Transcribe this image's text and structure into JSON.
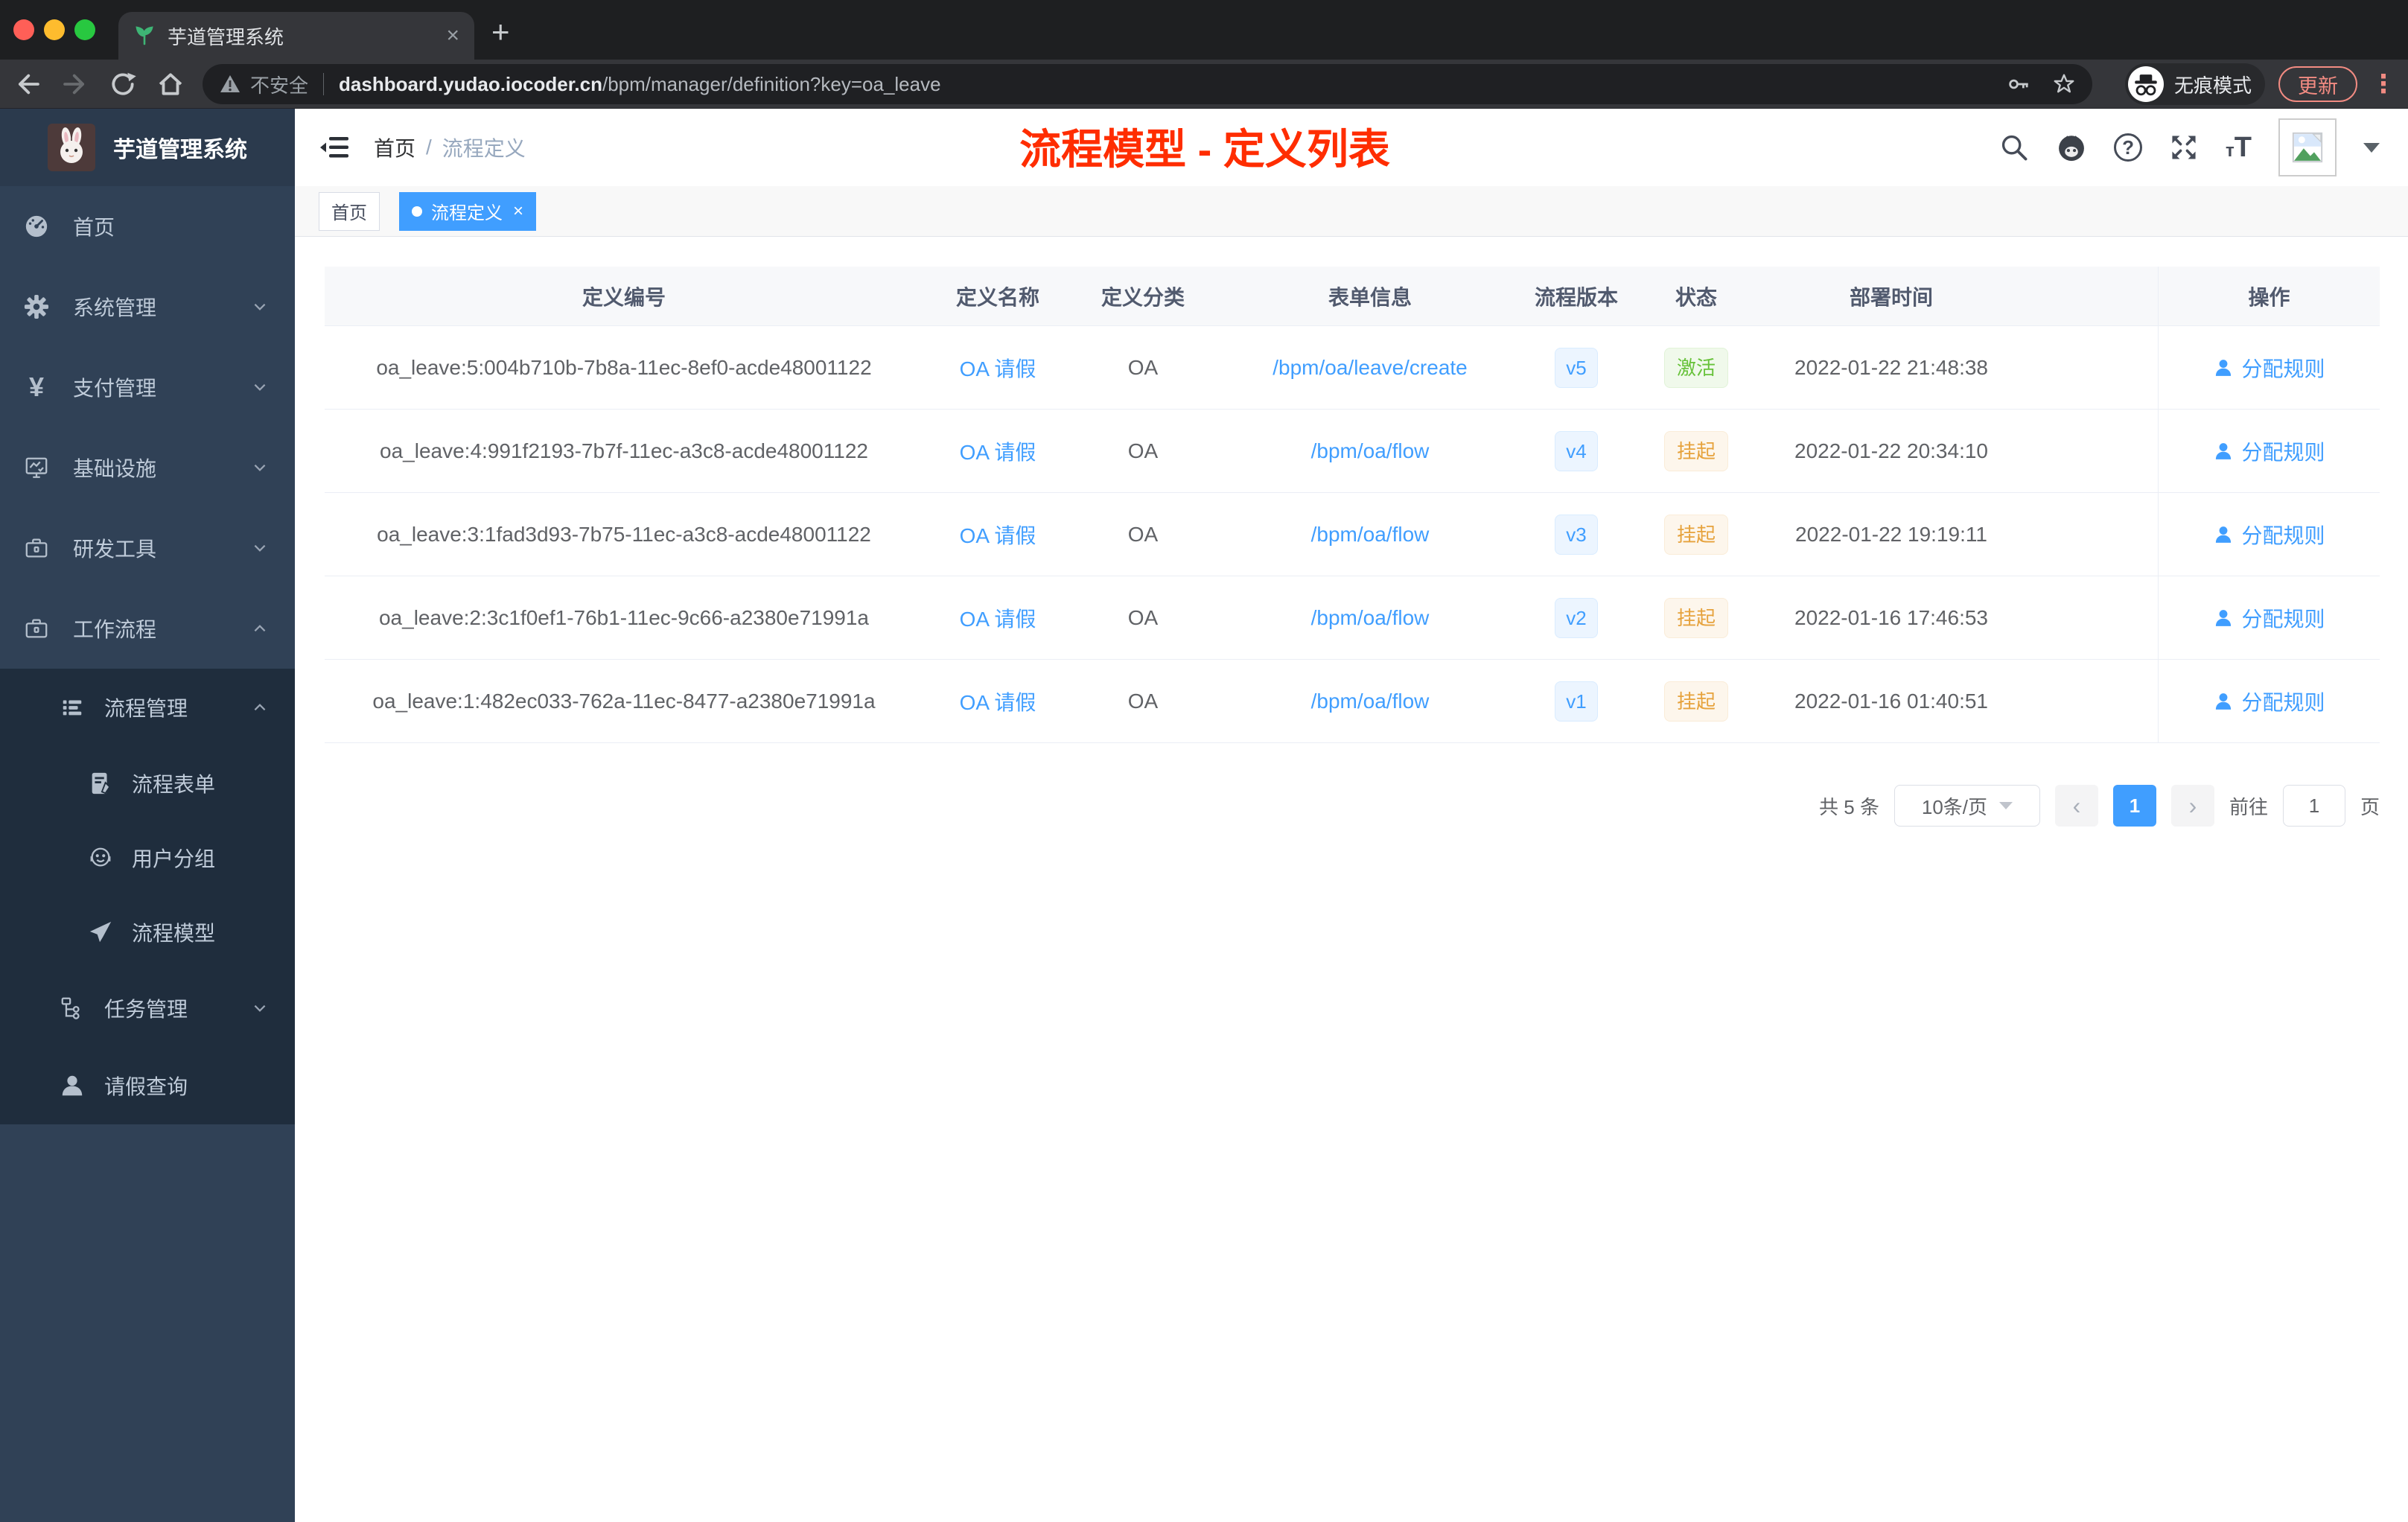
{
  "browser": {
    "traffic_lights": [
      "#ff5f57",
      "#febc2e",
      "#28c840"
    ],
    "tab": {
      "title": "芋道管理系统",
      "close": "×",
      "new_tab": "+"
    },
    "toolbar": {
      "security_label": "不安全",
      "url_host": "dashboard.yudao.iocoder.cn",
      "url_path": "/bpm/manager/definition?key=oa_leave",
      "incognito_label": "无痕模式",
      "update_label": "更新",
      "menu_dots": "⋮"
    }
  },
  "header": {
    "breadcrumb_home": "首页",
    "breadcrumb_sep": "/",
    "breadcrumb_current": "流程定义",
    "annotation": "流程模型 - 定义列表",
    "annotation_color": "#ff2d00",
    "help_glyph": "?",
    "textsize_small": "т",
    "textsize_big": "T"
  },
  "sidebar": {
    "app_title": "芋道管理系统",
    "items": [
      {
        "label": "首页"
      },
      {
        "label": "系统管理"
      },
      {
        "label": "支付管理"
      },
      {
        "label": "基础设施"
      },
      {
        "label": "研发工具"
      },
      {
        "label": "工作流程"
      }
    ],
    "sub_items": [
      {
        "label": "流程管理"
      },
      {
        "label": "流程表单"
      },
      {
        "label": "用户分组"
      },
      {
        "label": "流程模型"
      },
      {
        "label": "任务管理"
      },
      {
        "label": "请假查询"
      }
    ]
  },
  "tags": {
    "home": "首页",
    "current": "流程定义",
    "close": "×"
  },
  "table": {
    "columns": [
      "定义编号",
      "定义名称",
      "定义分类",
      "表单信息",
      "流程版本",
      "状态",
      "部署时间",
      "操作"
    ],
    "action_label": "分配规则",
    "accent_color": "#409eff",
    "status_colors": {
      "success": "#67c23a",
      "warning": "#e6a23c"
    },
    "rows": [
      {
        "id": "oa_leave:5:004b710b-7b8a-11ec-8ef0-acde48001122",
        "name": "OA 请假",
        "category": "OA",
        "form": "/bpm/oa/leave/create",
        "version": "v5",
        "status": "激活",
        "status_type": "success",
        "time": "2022-01-22 21:48:38"
      },
      {
        "id": "oa_leave:4:991f2193-7b7f-11ec-a3c8-acde48001122",
        "name": "OA 请假",
        "category": "OA",
        "form": "/bpm/oa/flow",
        "version": "v4",
        "status": "挂起",
        "status_type": "warning",
        "time": "2022-01-22 20:34:10"
      },
      {
        "id": "oa_leave:3:1fad3d93-7b75-11ec-a3c8-acde48001122",
        "name": "OA 请假",
        "category": "OA",
        "form": "/bpm/oa/flow",
        "version": "v3",
        "status": "挂起",
        "status_type": "warning",
        "time": "2022-01-22 19:19:11"
      },
      {
        "id": "oa_leave:2:3c1f0ef1-76b1-11ec-9c66-a2380e71991a",
        "name": "OA 请假",
        "category": "OA",
        "form": "/bpm/oa/flow",
        "version": "v2",
        "status": "挂起",
        "status_type": "warning",
        "time": "2022-01-16 17:46:53"
      },
      {
        "id": "oa_leave:1:482ec033-762a-11ec-8477-a2380e71991a",
        "name": "OA 请假",
        "category": "OA",
        "form": "/bpm/oa/flow",
        "version": "v1",
        "status": "挂起",
        "status_type": "warning",
        "time": "2022-01-16 01:40:51"
      }
    ]
  },
  "pagination": {
    "total": "共 5 条",
    "page_size": "10条/页",
    "prev": "‹",
    "current": "1",
    "next": "›",
    "goto_label": "前往",
    "goto_value": "1",
    "page_unit": "页"
  }
}
